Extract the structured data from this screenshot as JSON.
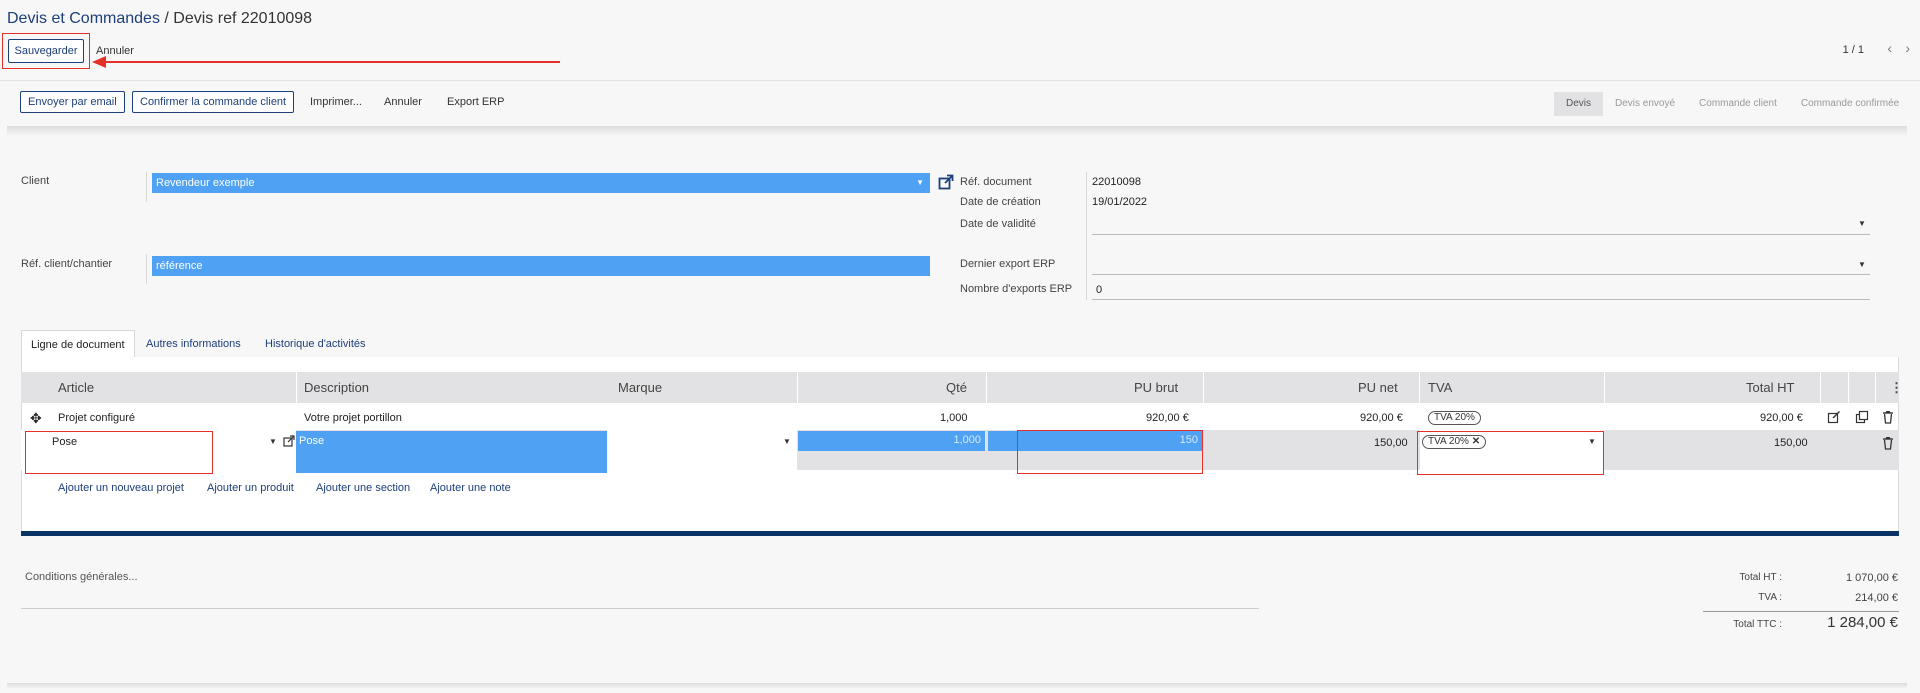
{
  "header": {
    "breadcrumb_parent": "Devis et Commandes",
    "breadcrumb_sep": " / ",
    "breadcrumb_current": "Devis ref 22010098",
    "save_label": "Sauvegarder",
    "discard_label": "Annuler",
    "pager": "1 / 1"
  },
  "actions": {
    "email": "Envoyer par email",
    "confirm": "Confirmer la commande client",
    "print": "Imprimer...",
    "cancel": "Annuler",
    "export": "Export ERP"
  },
  "status": {
    "stages": [
      "Devis",
      "Devis envoyé",
      "Commande client",
      "Commande confirmée"
    ],
    "active": "Devis"
  },
  "form": {
    "client_label": "Client",
    "client_value": "Revendeur exemple",
    "ref_label": "Réf. client/chantier",
    "ref_value": "référence",
    "doc_ref_label": "Réf. document",
    "doc_ref_value": "22010098",
    "created_label": "Date de création",
    "created_value": "19/01/2022",
    "validity_label": "Date de validité",
    "export_label": "Dernier export ERP",
    "nb_export_label": "Nombre d'exports ERP",
    "nb_export_value": "0"
  },
  "tabs": [
    "Ligne de document",
    "Autres informations",
    "Historique d'activités"
  ],
  "table": {
    "headers": {
      "article": "Article",
      "description": "Description",
      "marque": "Marque",
      "qty": "Qté",
      "pu_brut": "PU brut",
      "pu_net": "PU net",
      "tva": "TVA",
      "total": "Total HT"
    },
    "row1": {
      "article": "Projet configuré",
      "description": "Votre projet portillon",
      "qty": "1,000",
      "pu_brut": "920,00 €",
      "pu_net": "920,00 €",
      "tva": "TVA 20%",
      "total": "920,00 €"
    },
    "row2": {
      "article": "Pose",
      "description": "Pose",
      "qty": "1,000",
      "pu_brut": "150",
      "pu_net": "150,00",
      "tva": "TVA 20%",
      "total": "150,00"
    },
    "add_links": [
      "Ajouter un nouveau projet",
      "Ajouter un produit",
      "Ajouter une section",
      "Ajouter une note"
    ]
  },
  "footer": {
    "conditions_placeholder": "Conditions générales...",
    "total_ht_label": "Total HT :",
    "total_ht_value": "1 070,00 €",
    "tva_label": "TVA :",
    "tva_value": "214,00 €",
    "total_ttc_label": "Total TTC :",
    "total_ttc_value": "1 284,00 €"
  },
  "colors": {
    "accent": "#1d3f7a",
    "field_blue": "#4ea1f3",
    "annotation_red": "#e5302a"
  }
}
